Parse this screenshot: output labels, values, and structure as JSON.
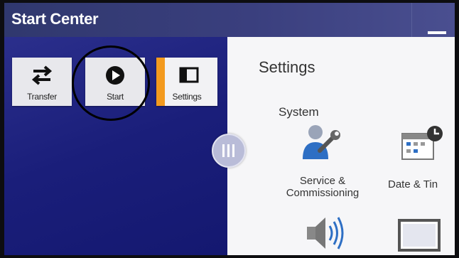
{
  "window": {
    "title": "Start Center"
  },
  "left_tiles": [
    {
      "label": "Transfer",
      "icon": "transfer-icon"
    },
    {
      "label": "Start",
      "icon": "play-icon"
    },
    {
      "label": "Settings",
      "icon": "settings-panel-icon",
      "selected": true
    }
  ],
  "settings_panel": {
    "heading": "Settings",
    "group": "System",
    "items": [
      {
        "label_line1": "Service &",
        "label_line2": "Commissioning",
        "icon": "service-wrench-icon"
      },
      {
        "label": "Date & Tin",
        "icon": "calendar-clock-icon"
      },
      {
        "icon": "speaker-icon"
      },
      {
        "icon": "display-icon"
      }
    ]
  },
  "colors": {
    "accent": "#f39a1e",
    "left_panel": "#1b1f7a",
    "titlebar": "#3a3f7e",
    "icon_blue": "#2e6fc4"
  }
}
